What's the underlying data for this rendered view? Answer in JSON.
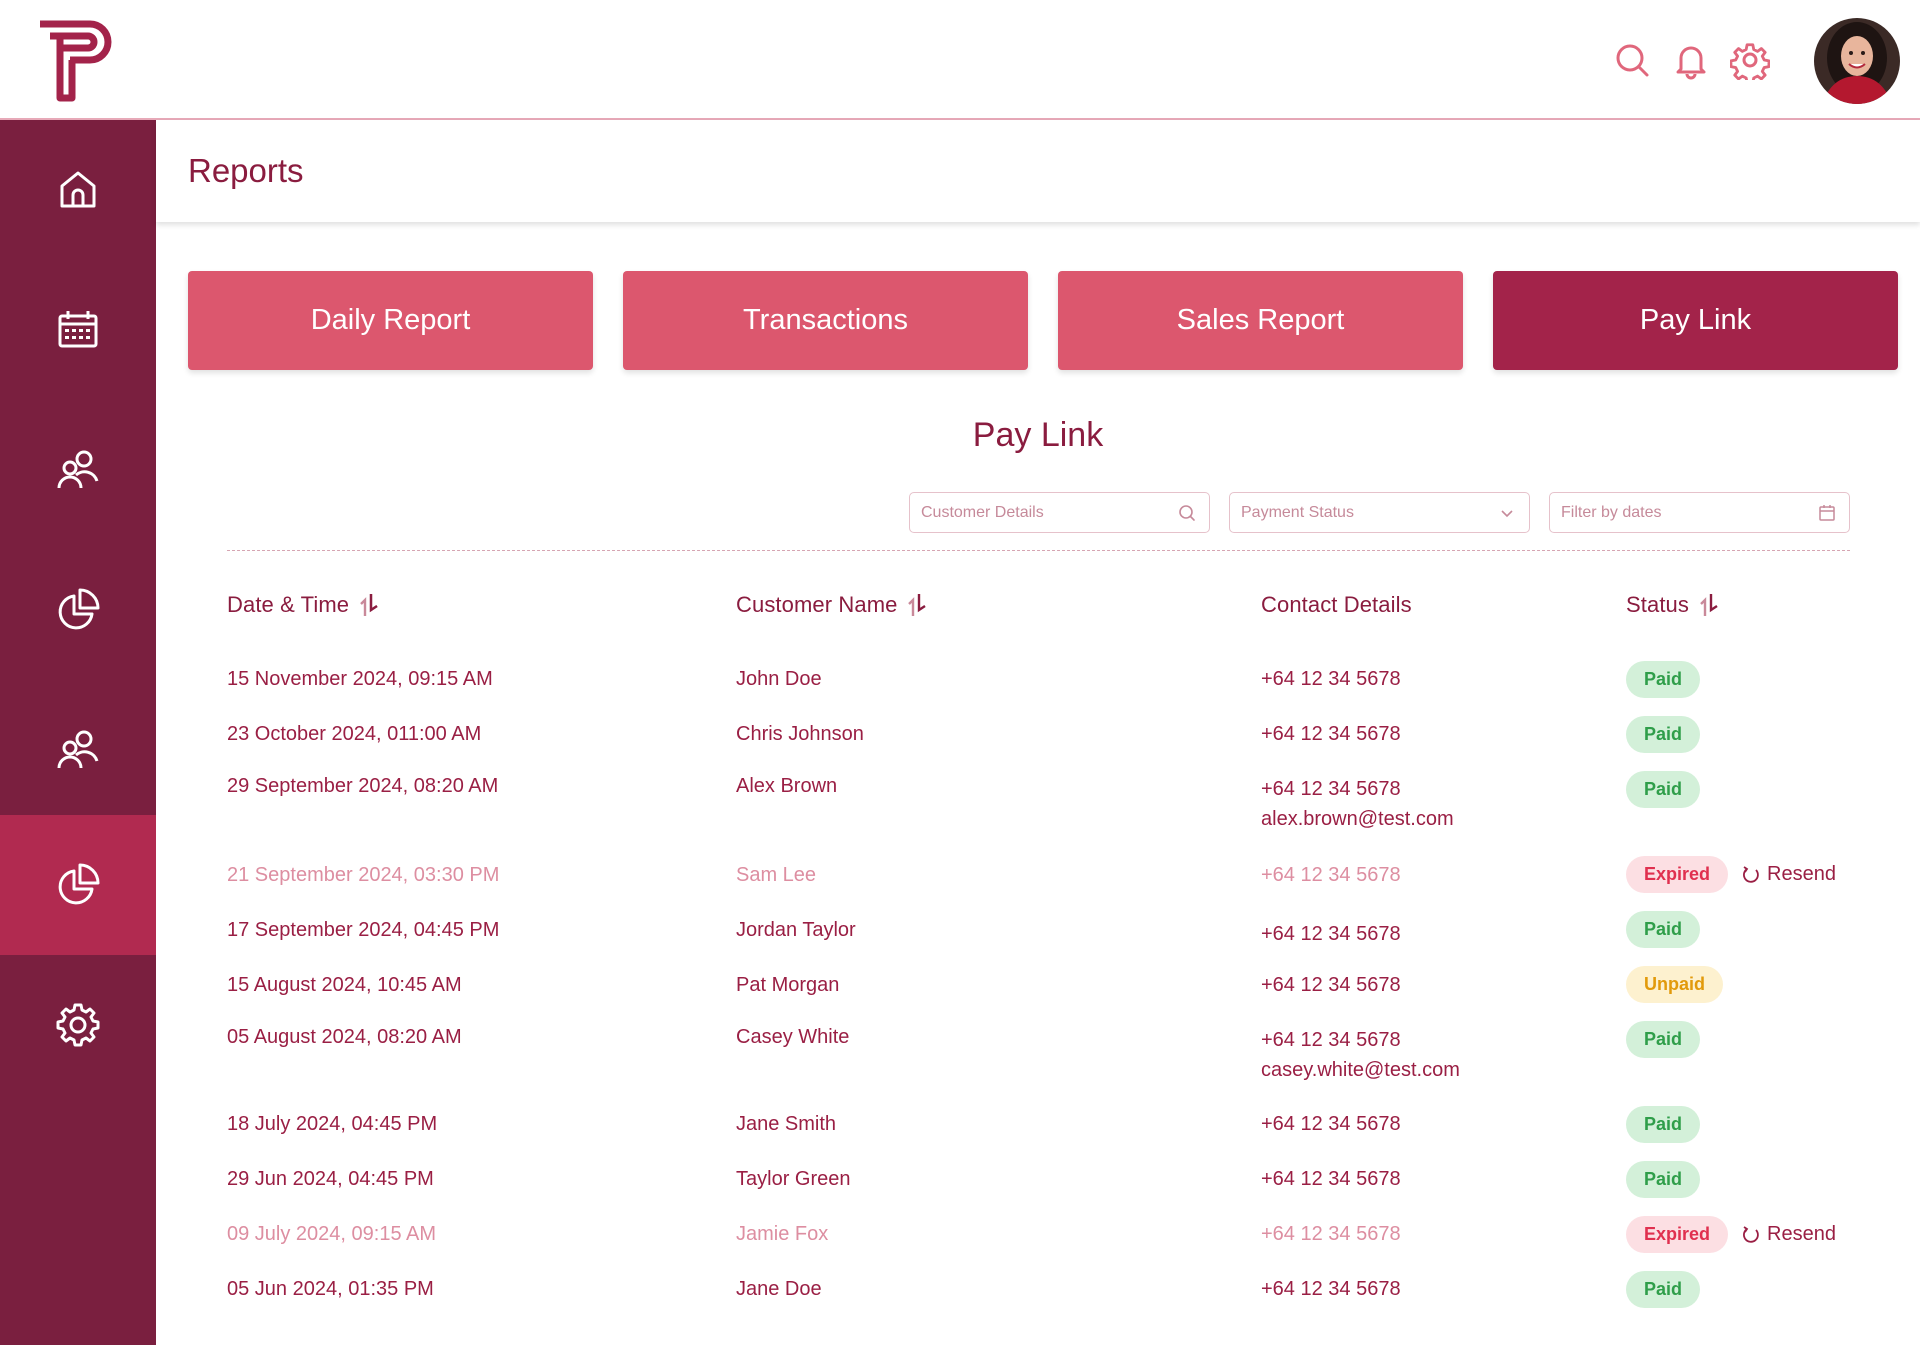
{
  "header": {
    "page_title": "Reports"
  },
  "topbar": {
    "icons": [
      "search-icon",
      "bell-icon",
      "gear-icon"
    ]
  },
  "sidebar": {
    "items": [
      "home-icon",
      "calendar-icon",
      "users-icon",
      "pie-chart-icon",
      "users-icon",
      "pie-chart-icon",
      "gear-icon"
    ],
    "active_index": 5
  },
  "report_buttons": {
    "daily": "Daily Report",
    "transactions": "Transactions",
    "sales": "Sales Report",
    "paylink": "Pay Link",
    "active": "Pay Link"
  },
  "section_title": "Pay Link",
  "filters": {
    "customer": {
      "placeholder": "Customer Details"
    },
    "status": {
      "placeholder": "Payment Status"
    },
    "dates": {
      "placeholder": "Filter by dates"
    }
  },
  "table": {
    "columns": {
      "date": "Date & Time",
      "name": "Customer Name",
      "contact": "Contact Details",
      "status": "Status"
    },
    "resend_label": "Resend",
    "rows": [
      {
        "date": "15 November 2024, 09:15 AM",
        "name": "John Doe",
        "phone": "+64 12 34 5678",
        "email": "",
        "status": "Paid"
      },
      {
        "date": "23 October 2024, 011:00 AM",
        "name": "Chris Johnson",
        "phone": "+64 12 34 5678",
        "email": "",
        "status": "Paid"
      },
      {
        "date": "29 September 2024, 08:20 AM",
        "name": "Alex Brown",
        "phone": "+64 12 34 5678",
        "email": "alex.brown@test.com",
        "status": "Paid"
      },
      {
        "date": "21 September 2024, 03:30 PM",
        "name": "Sam Lee",
        "phone": "+64 12 34 5678",
        "email": "",
        "status": "Expired"
      },
      {
        "date": "17 September 2024, 04:45 PM",
        "name": "Jordan Taylor",
        "phone": "+64 12 34 5678",
        "email": "",
        "status": "Paid"
      },
      {
        "date": "15 August 2024, 10:45 AM",
        "name": "Pat Morgan",
        "phone": "+64 12 34 5678",
        "email": "",
        "status": "Unpaid"
      },
      {
        "date": "05 August 2024, 08:20 AM",
        "name": "Casey White",
        "phone": "+64 12 34 5678",
        "email": "casey.white@test.com",
        "status": "Paid"
      },
      {
        "date": "18 July 2024, 04:45 PM",
        "name": "Jane Smith",
        "phone": "+64 12 34 5678",
        "email": "",
        "status": "Paid"
      },
      {
        "date": "29 Jun 2024, 04:45 PM",
        "name": "Taylor Green",
        "phone": "+64 12 34 5678",
        "email": "",
        "status": "Paid"
      },
      {
        "date": "09 July 2024, 09:15 AM",
        "name": "Jamie Fox",
        "phone": "+64 12 34 5678",
        "email": "",
        "status": "Expired"
      },
      {
        "date": "05 Jun 2024, 01:35 PM",
        "name": "Jane Doe",
        "phone": "+64 12 34 5678",
        "email": "",
        "status": "Paid"
      }
    ]
  },
  "colors": {
    "brand": "#7a1f3f",
    "accent": "#dc576e",
    "active": "#a3234a",
    "paid": "#2f9e4a",
    "expired": "#e0304f",
    "unpaid": "#e29a0b"
  }
}
